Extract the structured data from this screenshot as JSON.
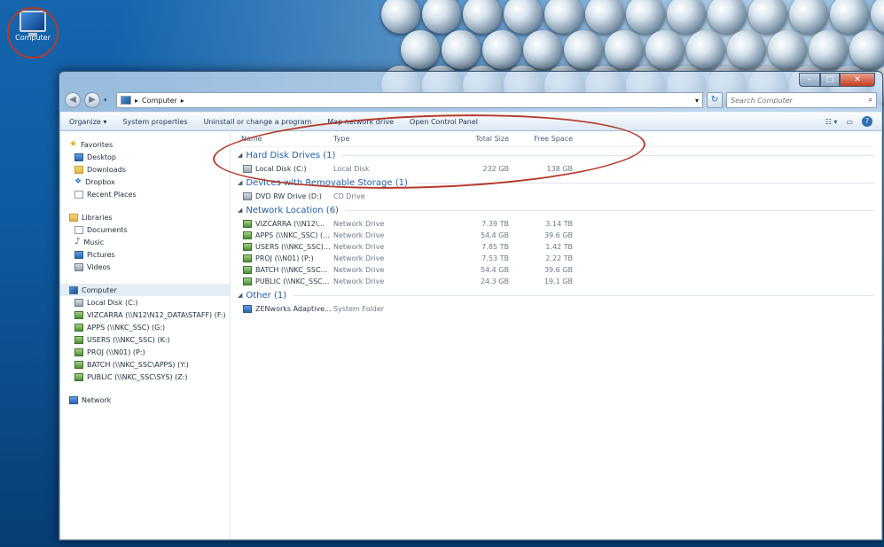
{
  "desktop": {
    "computer_label": "Computer"
  },
  "address": {
    "path": "Computer",
    "separator": "▸"
  },
  "search": {
    "placeholder": "Search Computer"
  },
  "toolbar": {
    "items": [
      "Organize ▾",
      "System properties",
      "Uninstall or change a program",
      "Map network drive",
      "Open Control Panel"
    ]
  },
  "nav": {
    "favorites": {
      "label": "Favorites",
      "items": [
        "Desktop",
        "Downloads",
        "Dropbox",
        "Recent Places"
      ]
    },
    "libraries": {
      "label": "Libraries",
      "items": [
        "Documents",
        "Music",
        "Pictures",
        "Videos"
      ]
    },
    "computer": {
      "label": "Computer",
      "items": [
        "Local Disk (C:)",
        "VIZCARRA (\\\\N12\\N12_DATA\\STAFF) (F:)",
        "APPS (\\\\NKC_SSC) (G:)",
        "USERS (\\\\NKC_SSC) (K:)",
        "PROJ (\\\\N01) (P:)",
        "BATCH (\\\\NKC_SSC\\APPS) (Y:)",
        "PUBLIC (\\\\NKC_SSC\\SYS) (Z:)"
      ]
    },
    "network": {
      "label": "Network"
    }
  },
  "columns": {
    "name": "Name",
    "type": "Type",
    "total": "Total Size",
    "free": "Free Space"
  },
  "groups": {
    "hdd": {
      "label": "Hard Disk Drives (1)",
      "rows": [
        {
          "name": "Local Disk (C:)",
          "type": "Local Disk",
          "total": "232 GB",
          "free": "138 GB"
        }
      ]
    },
    "removable": {
      "label": "Devices with Removable Storage (1)",
      "rows": [
        {
          "name": "DVD RW Drive (D:)",
          "type": "CD Drive"
        }
      ]
    },
    "network": {
      "label": "Network Location (6)",
      "rows": [
        {
          "name": "VIZCARRA (\\\\N12\\...",
          "type": "Network Drive",
          "total": "7.39 TB",
          "free": "3.14 TB"
        },
        {
          "name": "APPS (\\\\NKC_SSC) (...",
          "type": "Network Drive",
          "total": "54.4 GB",
          "free": "39.6 GB"
        },
        {
          "name": "USERS (\\\\NKC_SSC)...",
          "type": "Network Drive",
          "total": "7.85 TB",
          "free": "1.42 TB"
        },
        {
          "name": "PROJ (\\\\N01) (P:)",
          "type": "Network Drive",
          "total": "7.53 TB",
          "free": "2.22 TB"
        },
        {
          "name": "BATCH (\\\\NKC_SSC...",
          "type": "Network Drive",
          "total": "54.4 GB",
          "free": "39.6 GB"
        },
        {
          "name": "PUBLIC (\\\\NKC_SSC...",
          "type": "Network Drive",
          "total": "24.3 GB",
          "free": "19.1 GB"
        }
      ]
    },
    "other": {
      "label": "Other (1)",
      "rows": [
        {
          "name": "ZENworks Adaptive...",
          "type": "System Folder"
        }
      ]
    }
  },
  "colors": {
    "annotation_ring": "#b53a2a",
    "group_heading": "#1f5fa8"
  }
}
